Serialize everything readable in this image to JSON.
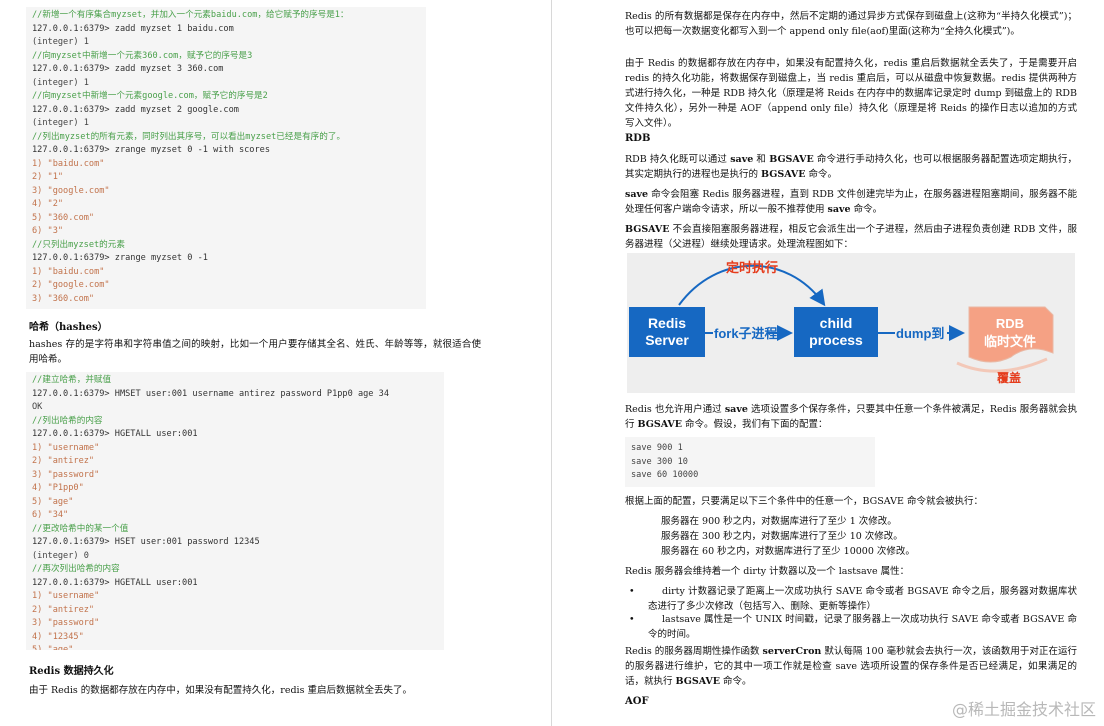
{
  "left": {
    "code1": [
      {
        "t": "//新增一个有序集合myzset，并加入一个元素baidu.com，给它赋予的序号是1：",
        "k": "cm"
      },
      {
        "t": "127.0.0.1:6379> zadd myzset 1 baidu.com",
        "k": "cmd"
      },
      {
        "t": "(integer) 1",
        "k": "out"
      },
      {
        "t": "//向myzset中新增一个元素360.com，赋予它的序号是3",
        "k": "cm"
      },
      {
        "t": "127.0.0.1:6379> zadd myzset 3 360.com",
        "k": "cmd"
      },
      {
        "t": "(integer) 1",
        "k": "out"
      },
      {
        "t": "//向myzset中新增一个元素google.com，赋予它的序号是2",
        "k": "cm"
      },
      {
        "t": "127.0.0.1:6379> zadd myzset 2 google.com",
        "k": "cmd"
      },
      {
        "t": "(integer) 1",
        "k": "out"
      },
      {
        "t": "//列出myzset的所有元素，同时列出其序号，可以看出myzset已经是有序的了。",
        "k": "cm"
      },
      {
        "t": "127.0.0.1:6379> zrange myzset 0 -1 with scores",
        "k": "cmd"
      },
      {
        "t": "1) \"baidu.com\"",
        "k": "val"
      },
      {
        "t": "2) \"1\"",
        "k": "val"
      },
      {
        "t": "3) \"google.com\"",
        "k": "val"
      },
      {
        "t": "4) \"2\"",
        "k": "val"
      },
      {
        "t": "5) \"360.com\"",
        "k": "val"
      },
      {
        "t": "6) \"3\"",
        "k": "val"
      },
      {
        "t": "//只列出myzset的元素",
        "k": "cm"
      },
      {
        "t": "127.0.0.1:6379> zrange myzset 0 -1",
        "k": "cmd"
      },
      {
        "t": "1) \"baidu.com\"",
        "k": "val"
      },
      {
        "t": "2) \"google.com\"",
        "k": "val"
      },
      {
        "t": "3) \"360.com\"",
        "k": "val"
      }
    ],
    "hashes_heading": "哈希（hashes）",
    "hashes_intro": "hashes 存的是字符串和字符串值之间的映射，比如一个用户要存储其全名、姓氏、年龄等等，就很适合使用哈希。",
    "code2": [
      {
        "t": "//建立哈希，并赋值",
        "k": "cm"
      },
      {
        "t": "127.0.0.1:6379> HMSET user:001 username antirez password P1pp0 age 34",
        "k": "cmd"
      },
      {
        "t": "OK",
        "k": "out"
      },
      {
        "t": "//列出哈希的内容",
        "k": "cm"
      },
      {
        "t": "127.0.0.1:6379> HGETALL user:001",
        "k": "cmd"
      },
      {
        "t": "1) \"username\"",
        "k": "val"
      },
      {
        "t": "2) \"antirez\"",
        "k": "val"
      },
      {
        "t": "3) \"password\"",
        "k": "val"
      },
      {
        "t": "4) \"P1pp0\"",
        "k": "val"
      },
      {
        "t": "5) \"age\"",
        "k": "val"
      },
      {
        "t": "6) \"34\"",
        "k": "val"
      },
      {
        "t": "//更改哈希中的某一个值",
        "k": "cm"
      },
      {
        "t": "127.0.0.1:6379> HSET user:001 password 12345",
        "k": "cmd"
      },
      {
        "t": "(integer) 0",
        "k": "out"
      },
      {
        "t": "//再次列出哈希的内容",
        "k": "cm"
      },
      {
        "t": "127.0.0.1:6379> HGETALL user:001",
        "k": "cmd"
      },
      {
        "t": "1) \"username\"",
        "k": "val"
      },
      {
        "t": "2) \"antirez\"",
        "k": "val"
      },
      {
        "t": "3) \"password\"",
        "k": "val"
      },
      {
        "t": "4) \"12345\"",
        "k": "val"
      },
      {
        "t": "5) \"age\"",
        "k": "val"
      },
      {
        "t": "6) \"34\"",
        "k": "val"
      }
    ],
    "persist_heading": "Redis 数据持久化",
    "persist_intro": "由于 Redis 的数据都存放在内存中，如果没有配置持久化，redis 重启后数据就全丢失了。"
  },
  "right": {
    "p1": "Redis 的所有数据都是保存在内存中，然后不定期的通过异步方式保存到磁盘上(这称为“半持久化模式”)；也可以把每一次数据变化都写入到一个 append only file(aof)里面(这称为“全持久化模式”)。",
    "p2": "由于 Redis 的数据都存放在内存中，如果没有配置持久化，redis 重启后数据就全丢失了，于是需要开启 redis 的持久化功能，将数据保存到磁盘上，当 redis 重启后，可以从磁盘中恢复数据。redis 提供两种方式进行持久化，一种是 RDB 持久化（原理是将 Reids 在内存中的数据库记录定时 dump 到磁盘上的 RDB 文件持久化），另外一种是 AOF（append only file）持久化（原理是将 Reids 的操作日志以追加的方式写入文件）。",
    "rdb_heading": "RDB",
    "p3_a": "RDB 持久化既可以通过 ",
    "p3_save": "save",
    "p3_b": " 和 ",
    "p3_bgsave": "BGSAVE",
    "p3_c": " 命令进行手动持久化，也可以根据服务器配置选项定期执行，其实定期执行的进程也是执行的 ",
    "p3_bgsave2": "BGSAVE",
    "p3_d": " 命令。",
    "p4_save": "save",
    "p4_a": " 命令会阻塞 Redis 服务器进程，直到 RDB 文件创建完毕为止，在服务器进程阻塞期间，服务器不能处理任何客户端命令请求，所以一般不推荐使用 ",
    "p4_save2": "save",
    "p4_b": " 命令。",
    "p5_bgsave": "BGSAVE",
    "p5_a": " 不会直接阻塞服务器进程，相反它会派生出一个子进程，然后由子进程负责创建 RDB 文件，服务器进程（父进程）继续处理请求。处理流程图如下：",
    "diagram": {
      "timer_label": "定时执行",
      "redis_server": "Redis\nServer",
      "fork_label": "fork子进程",
      "child_process": "child\nprocess",
      "dump_label": "dump到",
      "rdb_file": "RDB\n临时文件",
      "overwrite_label": "覆盖",
      "colors": {
        "box": "#1668c2",
        "file": "#f5a184",
        "red": "#e53c1c",
        "arrow": "#1668c2"
      }
    },
    "p6_a": "Redis 也允许用户通过 ",
    "p6_save": "save",
    "p6_b": " 选项设置多个保存条件，只要其中任意一个条件被满足，Redis 服务器就会执行 ",
    "p6_bgsave": "BGSAVE",
    "p6_c": " 命令。假设，我们有下面的配置：",
    "config": [
      "save 900 1",
      "save 300 10",
      "save 60 10000"
    ],
    "p7": "根据上面的配置，只要满足以下三个条件中的任意一个，BGSAVE 命令就会被执行：",
    "conditions": [
      "服务器在 900 秒之内，对数据库进行了至少 1 次修改。",
      "服务器在 300 秒之内，对数据库进行了至少 10 次修改。",
      "服务器在 60 秒之内，对数据库进行了至少 10000 次修改。"
    ],
    "p8": "Redis 服务器会维持着一个 dirty 计数器以及一个 lastsave 属性：",
    "bullets": [
      "dirty 计数器记录了距离上一次成功执行 SAVE 命令或者 BGSAVE 命令之后，服务器对数据库状态进行了多少次修改（包括写入、删除、更新等操作）",
      "lastsave 属性是一个 UNIX 时间戳，记录了服务器上一次成功执行 SAVE 命令或者 BGSAVE 命令的时间。"
    ],
    "p9_a": "Redis 的服务器周期性操作函数 ",
    "p9_cron": "serverCron",
    "p9_b": " 默认每隔 100 毫秒就会去执行一次，该函数用于对正在运行的服务器进行维护，它的其中一项工作就是检查 save 选项所设置的保存条件是否已经满足，如果满足的话，就执行 ",
    "p9_bgsave": "BGSAVE",
    "p9_c": " 命令。",
    "aof_heading": "AOF"
  },
  "watermark": "@稀土掘金技术社区"
}
